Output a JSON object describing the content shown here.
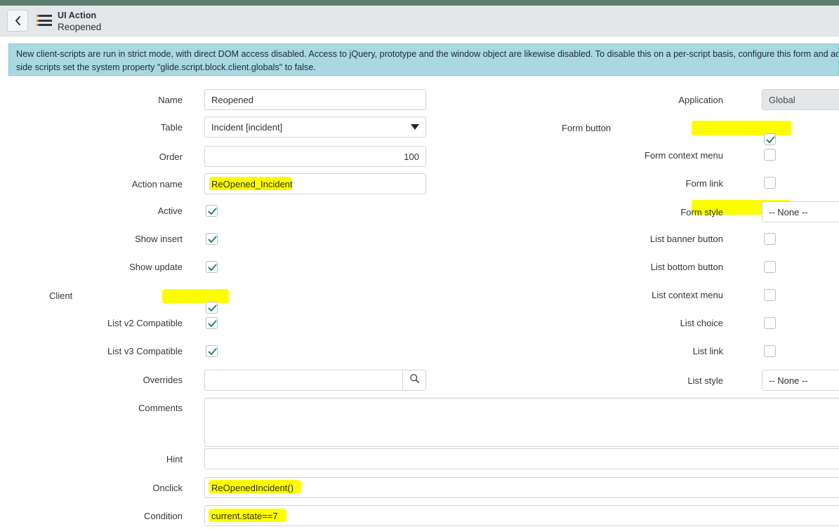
{
  "header": {
    "back_icon": "chevron-left-icon",
    "menu_icon": "hamburger-menu-icon",
    "kicker": "UI Action",
    "title": "Reopened"
  },
  "banner": {
    "line1": "New client-scripts are run in strict mode, with direct DOM access disabled. Access to jQuery, prototype and the window object are likewise disabled. To disable this on a per-script basis, configure this form and add the \"Is",
    "line2": "side scripts set the system property \"glide.script.block.client.globals\" to false."
  },
  "left_fields": {
    "name": {
      "label": "Name",
      "value": "Reopened"
    },
    "table": {
      "label": "Table",
      "value": "Incident [incident]"
    },
    "order": {
      "label": "Order",
      "value": "100"
    },
    "action_name": {
      "label": "Action name",
      "value": "ReOpened_Incident"
    },
    "active": {
      "label": "Active",
      "checked": true
    },
    "show_insert": {
      "label": "Show insert",
      "checked": true
    },
    "show_update": {
      "label": "Show update",
      "checked": true
    },
    "client": {
      "label": "Client",
      "checked": true
    },
    "list_v2": {
      "label": "List v2 Compatible",
      "checked": true
    },
    "list_v3": {
      "label": "List v3 Compatible",
      "checked": true
    },
    "overrides": {
      "label": "Overrides",
      "value": "",
      "lookup_icon": "search-icon"
    },
    "comments": {
      "label": "Comments",
      "value": ""
    },
    "hint": {
      "label": "Hint",
      "value": ""
    },
    "onclick": {
      "label": "Onclick",
      "value": "ReOpenedIncident()"
    },
    "condition": {
      "label": "Condition",
      "value": "current.state==7"
    }
  },
  "right_fields": {
    "application": {
      "label": "Application",
      "value": "Global"
    },
    "form_button": {
      "label": "Form button",
      "checked": true
    },
    "form_context_menu": {
      "label": "Form context menu",
      "checked": false
    },
    "form_link": {
      "label": "Form link",
      "checked": false
    },
    "form_style": {
      "label": "Form style",
      "value": "-- None --"
    },
    "list_banner_button": {
      "label": "List banner button",
      "checked": false
    },
    "list_bottom_button": {
      "label": "List bottom button",
      "checked": false
    },
    "list_context_menu": {
      "label": "List context menu",
      "checked": false
    },
    "list_choice": {
      "label": "List choice",
      "checked": false
    },
    "list_link": {
      "label": "List link",
      "checked": false
    },
    "list_style": {
      "label": "List style",
      "value": "-- None --"
    }
  },
  "colors": {
    "accent_strip": "#5d7f71",
    "header_bg": "#e3e7ea",
    "banner_bg": "#a9d8e3",
    "check_green": "#1f8a6e",
    "highlight": "#fdfd00"
  }
}
